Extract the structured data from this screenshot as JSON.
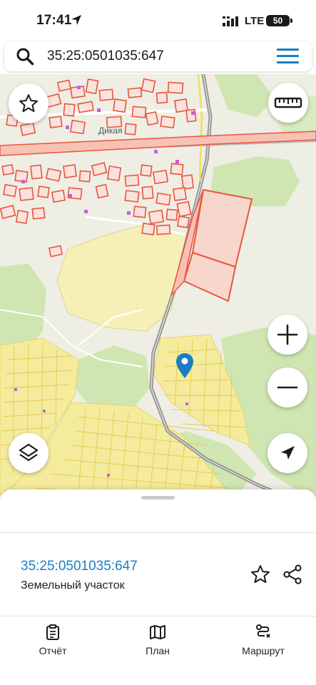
{
  "status_bar": {
    "time": "17:41",
    "network": "LTE",
    "battery": "50"
  },
  "search": {
    "value": "35:25:0501035:647"
  },
  "map": {
    "place_label": "Дикая"
  },
  "sheet": {
    "parcel_id": "35:25:0501035:647",
    "parcel_type": "Земельный участок"
  },
  "tabs": [
    {
      "label": "Отчёт",
      "icon": "report-icon"
    },
    {
      "label": "План",
      "icon": "map-plan-icon"
    },
    {
      "label": "Маршрут",
      "icon": "route-icon"
    }
  ],
  "colors": {
    "accent": "#1a7fc1",
    "parcel_outline": "#e8553f",
    "residential_zone": "#f4ec9c",
    "forest": "#cfe6b2",
    "road": "#8f8f8f"
  }
}
